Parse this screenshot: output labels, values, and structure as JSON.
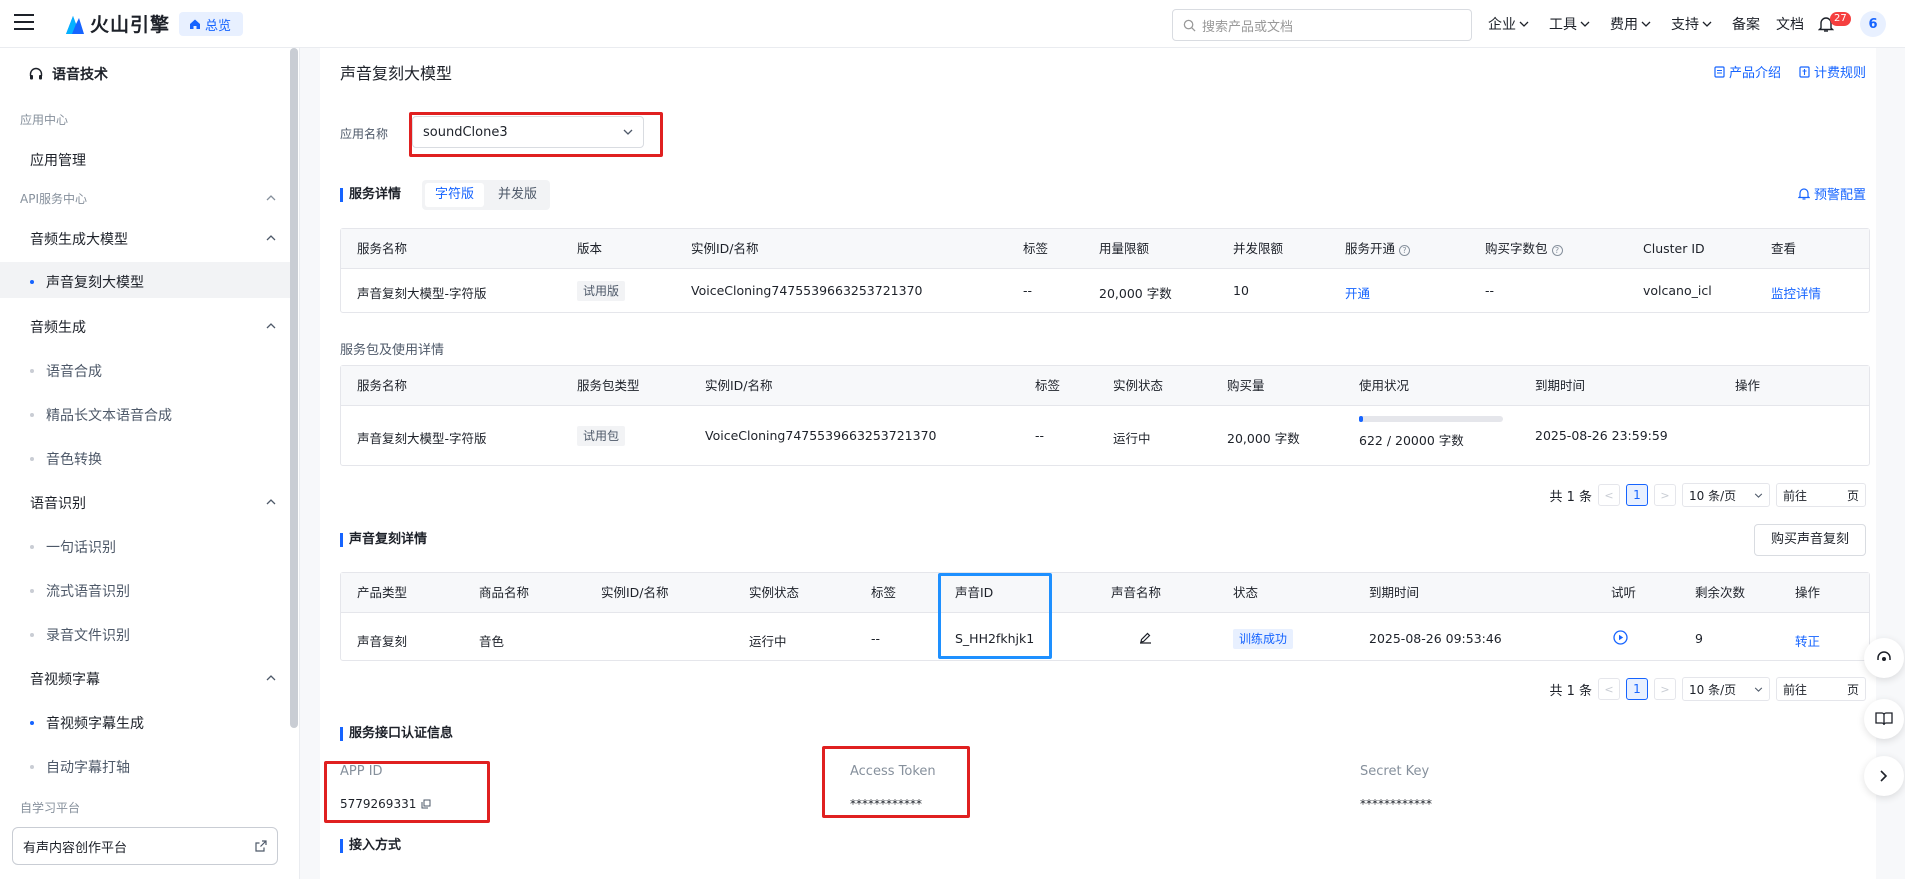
{
  "header": {
    "brand": "火山引擎",
    "home_label": "总览",
    "search_placeholder": "搜索产品或文档",
    "nav": [
      "企业",
      "工具",
      "费用",
      "支持"
    ],
    "nav_plain": [
      "备案",
      "文档"
    ],
    "notifications": "27",
    "avatar": "6"
  },
  "sidebar": {
    "title": "语音技术",
    "group_app": "应用中心",
    "app_manage": "应用管理",
    "group_api": "API服务中心",
    "cat_audio_gen_model": "音频生成大模型",
    "voice_clone_model": "声音复刻大模型",
    "cat_audio_gen": "音频生成",
    "tts": "语音合成",
    "long_tts": "精品长文本语音合成",
    "voice_convert": "音色转换",
    "cat_asr": "语音识别",
    "sentence_asr": "一句话识别",
    "stream_asr": "流式语音识别",
    "file_asr": "录音文件识别",
    "cat_subtitle": "音视频字幕",
    "subtitle_gen": "音视频字幕生成",
    "auto_caption": "自动字幕打轴",
    "group_self": "自学习平台",
    "ext_platform": "有声内容创作平台"
  },
  "main": {
    "title": "声音复刻大模型",
    "link_intro": "产品介绍",
    "link_billing": "计费规则",
    "app_label": "应用名称",
    "app_value": "soundClone3",
    "service_detail": "服务详情",
    "seg_char": "字符版",
    "seg_concurrent": "并发版",
    "alert_config": "预警配置",
    "service_table": {
      "headers": [
        "服务名称",
        "版本",
        "实例ID/名称",
        "标签",
        "用量限额",
        "并发限额",
        "服务开通",
        "购买字数包",
        "Cluster ID",
        "查看"
      ],
      "row": {
        "name": "声音复刻大模型-字符版",
        "version": "试用版",
        "instance": "VoiceCloning7475539663253721370",
        "tag": "--",
        "quota": "20,000 字数",
        "concurrency": "10",
        "activate": "开通",
        "package": "--",
        "cluster": "volcano_icl",
        "monitor": "监控详情"
      }
    },
    "package_title": "服务包及使用详情",
    "package_table": {
      "headers": [
        "服务名称",
        "服务包类型",
        "实例ID/名称",
        "标签",
        "实例状态",
        "购买量",
        "使用状况",
        "到期时间",
        "操作"
      ],
      "row": {
        "name": "声音复刻大模型-字符版",
        "type": "试用包",
        "instance": "VoiceCloning7475539663253721370",
        "tag": "--",
        "status": "运行中",
        "amount": "20,000 字数",
        "usage": "622 / 20000 字数",
        "usage_fraction": 0.031,
        "expire": "2025-08-26 23:59:59"
      }
    },
    "pager": {
      "total": "共 1 条",
      "page": "1",
      "size": "10 条/页",
      "goto": "前往",
      "unit": "页"
    },
    "clone_title": "声音复刻详情",
    "buy_clone": "购买声音复刻",
    "clone_table": {
      "headers": [
        "产品类型",
        "商品名称",
        "实例ID/名称",
        "实例状态",
        "标签",
        "声音ID",
        "声音名称",
        "状态",
        "到期时间",
        "试听",
        "剩余次数",
        "操作"
      ],
      "row": {
        "product": "声音复刻",
        "goods": "音色",
        "status": "运行中",
        "tag": "--",
        "voice_id": "S_HH2fkhjk1",
        "train_status": "训练成功",
        "expire": "2025-08-26 09:53:46",
        "remaining": "9",
        "action": "转正"
      }
    },
    "auth_title": "服务接口认证信息",
    "app_id_label": "APP ID",
    "app_id": "5779269331",
    "token_label": "Access Token",
    "token": "************",
    "secret_label": "Secret Key",
    "secret": "************",
    "access_title": "接入方式"
  },
  "colors": {
    "accent": "#1664ff",
    "highlight_red": "#e02020",
    "highlight_blue": "#1e90ff"
  }
}
